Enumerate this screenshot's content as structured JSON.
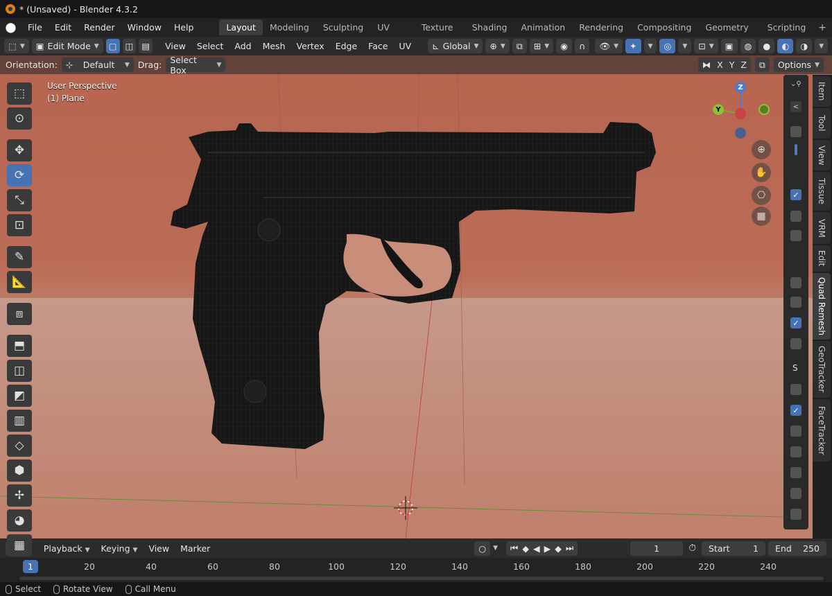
{
  "window": {
    "title": "* (Unsaved) - Blender 4.3.2"
  },
  "menu": {
    "items": [
      "File",
      "Edit",
      "Render",
      "Window",
      "Help"
    ]
  },
  "workspaces": {
    "tabs": [
      "Layout",
      "Modeling",
      "Sculpting",
      "UV Editing",
      "Texture Paint",
      "Shading",
      "Animation",
      "Rendering",
      "Compositing",
      "Geometry Nodes",
      "Scripting"
    ],
    "active": "Layout"
  },
  "header": {
    "mode": "Edit Mode",
    "menus": [
      "View",
      "Select",
      "Add",
      "Mesh",
      "Vertex",
      "Edge",
      "Face",
      "UV"
    ],
    "transform_orientation": "Global"
  },
  "tool_options": {
    "orientation_label": "Orientation:",
    "orientation_value": "Default",
    "drag_label": "Drag:",
    "drag_value": "Select Box",
    "axis_x": "X",
    "axis_y": "Y",
    "axis_z": "Z",
    "options_label": "Options"
  },
  "viewport": {
    "view_name": "User Perspective",
    "object_name": "(1) Plane"
  },
  "gizmo": {
    "z": "Z",
    "y": "Y"
  },
  "side_tabs": [
    "Item",
    "Tool",
    "View",
    "Tissue",
    "VRM",
    "Edit",
    "Quad Remesh",
    "GeoTracker",
    "FaceTracker"
  ],
  "side_tabs_active": "Quad Remesh",
  "panel": {
    "s_label": "S"
  },
  "timeline": {
    "menus": [
      "Playback",
      "Keying",
      "View",
      "Marker"
    ],
    "current_frame": "1",
    "start_label": "Start",
    "start_value": "1",
    "end_label": "End",
    "end_value": "250",
    "ticks": [
      "20",
      "40",
      "60",
      "80",
      "100",
      "120",
      "140",
      "160",
      "180",
      "200",
      "220",
      "240"
    ],
    "cursor_frame": "1"
  },
  "statusbar": {
    "select": "Select",
    "rotate": "Rotate View",
    "menu": "Call Menu"
  },
  "colors": {
    "accent": "#4772b3",
    "viewport_bg": "#bb6d57",
    "mesh": "#141414"
  }
}
